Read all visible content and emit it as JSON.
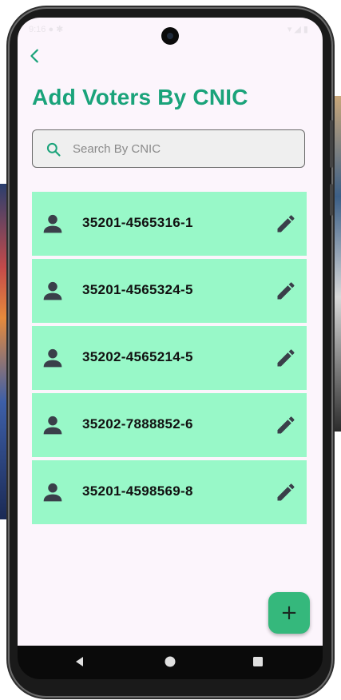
{
  "app": {
    "title": "Add Voters By CNIC"
  },
  "status_bar": {
    "left": "9:16 ● ✱",
    "right": "▾ ◢ ▮"
  },
  "search": {
    "placeholder": "Search By CNIC",
    "value": ""
  },
  "voters": [
    {
      "cnic": "35201-4565316-1"
    },
    {
      "cnic": "35201-4565324-5"
    },
    {
      "cnic": "35202-4565214-5"
    },
    {
      "cnic": "35202-7888852-6"
    },
    {
      "cnic": "35201-4598569-8"
    }
  ],
  "fab": {
    "label": "+"
  },
  "icons": {
    "back": "chevron-left-icon",
    "search": "search-icon",
    "person": "person-icon",
    "edit": "pencil-icon",
    "add": "plus-icon"
  },
  "colors": {
    "accent": "#1aa37a",
    "card": "#98f8c8",
    "fab": "#35b87c",
    "background": "#fcf5fc"
  }
}
